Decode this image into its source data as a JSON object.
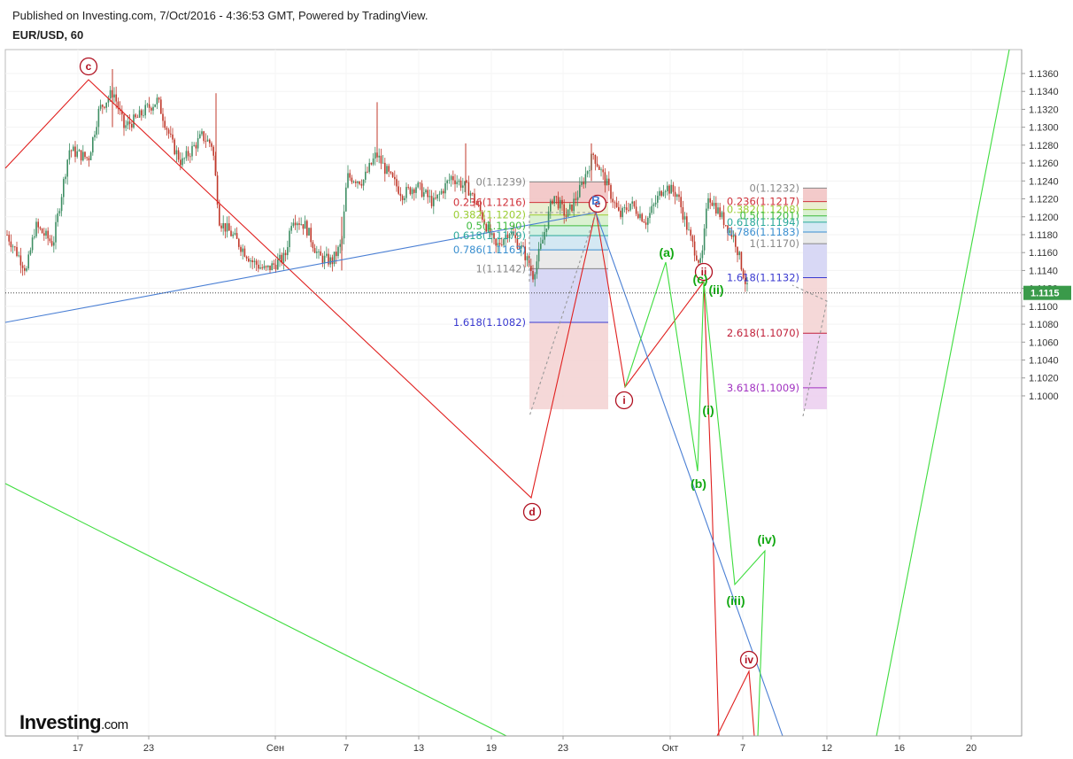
{
  "header": {
    "published": "Published on Investing.com, 7/Oct/2016 - 4:36:53 GMT, Powered by TradingView.",
    "symbol": "EUR/USD, 60"
  },
  "logo": {
    "main": "Investing",
    "suffix": ".com"
  },
  "colors": {
    "up": "#3e8e63",
    "down": "#c0392b",
    "red": "#e0201f",
    "blue": "#4a7fd4",
    "green": "#3ddc3d",
    "waveRed": "#b01020",
    "waveGreen": "#12a812"
  },
  "chart_data": {
    "type": "candlestick",
    "y_ticks": [
      "1.1360",
      "1.1340",
      "1.1320",
      "1.1300",
      "1.1280",
      "1.1260",
      "1.1240",
      "1.1220",
      "1.1200",
      "1.1180",
      "1.1160",
      "1.1140",
      "1.1120",
      "1.1100",
      "1.1080",
      "1.1060",
      "1.1040",
      "1.1020",
      "1.1000"
    ],
    "y_range": [
      1.0988,
      1.137
    ],
    "x_ticks": [
      "17",
      "23",
      "Сен",
      "7",
      "13",
      "19",
      "23",
      "Окт",
      "7",
      "12",
      "16",
      "20"
    ],
    "last_price": "1.1115",
    "fib_left": [
      {
        "label": "0(1.1239)",
        "color": "#888888"
      },
      {
        "label": "0.236(1.1216)",
        "color": "#d0323a"
      },
      {
        "label": "0.382(1.1202)",
        "color": "#9acd32"
      },
      {
        "label": "0.5(1.1190)",
        "color": "#3dbb3d"
      },
      {
        "label": "0.618(1.1179)",
        "color": "#2aa89a"
      },
      {
        "label": "0.786(1.1163)",
        "color": "#3a8fd0"
      },
      {
        "label": "1(1.1142)",
        "color": "#888888"
      },
      {
        "label": "1.618(1.1082)",
        "color": "#3a3ad0"
      }
    ],
    "fib_right": [
      {
        "label": "0(1.1232)",
        "color": "#888888"
      },
      {
        "label": "0.236(1.1217)",
        "color": "#d0323a"
      },
      {
        "label": "0.382(1.1208)",
        "color": "#9acd32"
      },
      {
        "label": "0.5(1.1201)",
        "color": "#3dbb3d"
      },
      {
        "label": "0.618(1.1194)",
        "color": "#2aa89a"
      },
      {
        "label": "0.786(1.1183)",
        "color": "#3a8fd0"
      },
      {
        "label": "1(1.1170)",
        "color": "#888888"
      },
      {
        "label": "1.618(1.1132)",
        "color": "#3a3ad0"
      },
      {
        "label": "2.618(1.1070)",
        "color": "#c0203a"
      },
      {
        "label": "3.618(1.1009)",
        "color": "#a030c0"
      }
    ],
    "wave_labels_red": [
      "c",
      "d",
      "e",
      "i",
      "ii",
      "iv"
    ],
    "wave_labels_green": [
      "(a)",
      "(b)",
      "(c)",
      "(i)",
      "(ii)",
      "(iii)",
      "(iv)"
    ],
    "wave_label_blue": "B"
  }
}
